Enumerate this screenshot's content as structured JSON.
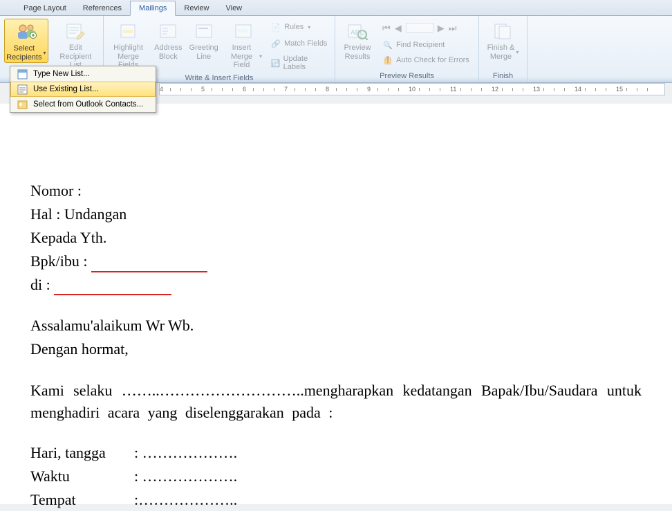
{
  "tabs": [
    "Page Layout",
    "References",
    "Mailings",
    "Review",
    "View"
  ],
  "active_tab": "Mailings",
  "ribbon": {
    "select_recipients": "Select\nRecipients",
    "edit_recipient_list": "Edit\nRecipient List",
    "highlight_merge": "Highlight\nMerge Fields",
    "address_block": "Address\nBlock",
    "greeting_line": "Greeting\nLine",
    "insert_merge_field": "Insert Merge\nField",
    "rules": "Rules",
    "match_fields": "Match Fields",
    "update_labels": "Update Labels",
    "wif_group": "Write & Insert Fields",
    "preview_results": "Preview\nResults",
    "find_recipient": "Find Recipient",
    "auto_check": "Auto Check for Errors",
    "preview_group": "Preview Results",
    "finish_merge": "Finish &\nMerge",
    "finish_group": "Finish"
  },
  "dropdown": {
    "type_new": "Type New List...",
    "use_existing": "Use Existing List...",
    "outlook": "Select from Outlook Contacts..."
  },
  "ruler_ticks": [
    4,
    5,
    6,
    7,
    8,
    9,
    10,
    11,
    12,
    13,
    14,
    15
  ],
  "doc": {
    "nomor": "Nomor :",
    "hal": "Hal : Undangan",
    "kepada": "Kepada Yth.",
    "bpk_label": "Bpk/ibu :  ",
    "di_label": "di :  ",
    "salam": "Assalamu'alaikum Wr Wb.",
    "hormat": "Dengan hormat,",
    "body1_a": "Kami  selaku  ",
    "body1_dots": "……..………………………..",
    "body1_b": "mengharapkan  kedatangan  Bapak/Ibu/Saudara  untuk menghadiri acara yang diselenggarakan pada :",
    "hari": "Hari, tangga",
    "waktu": "Waktu",
    "tempat": "Tempat",
    "colon_dots": ": ……………….",
    "colon_dots2": ":………………..",
    "red_len1": "168px",
    "red_len2": "170px"
  }
}
